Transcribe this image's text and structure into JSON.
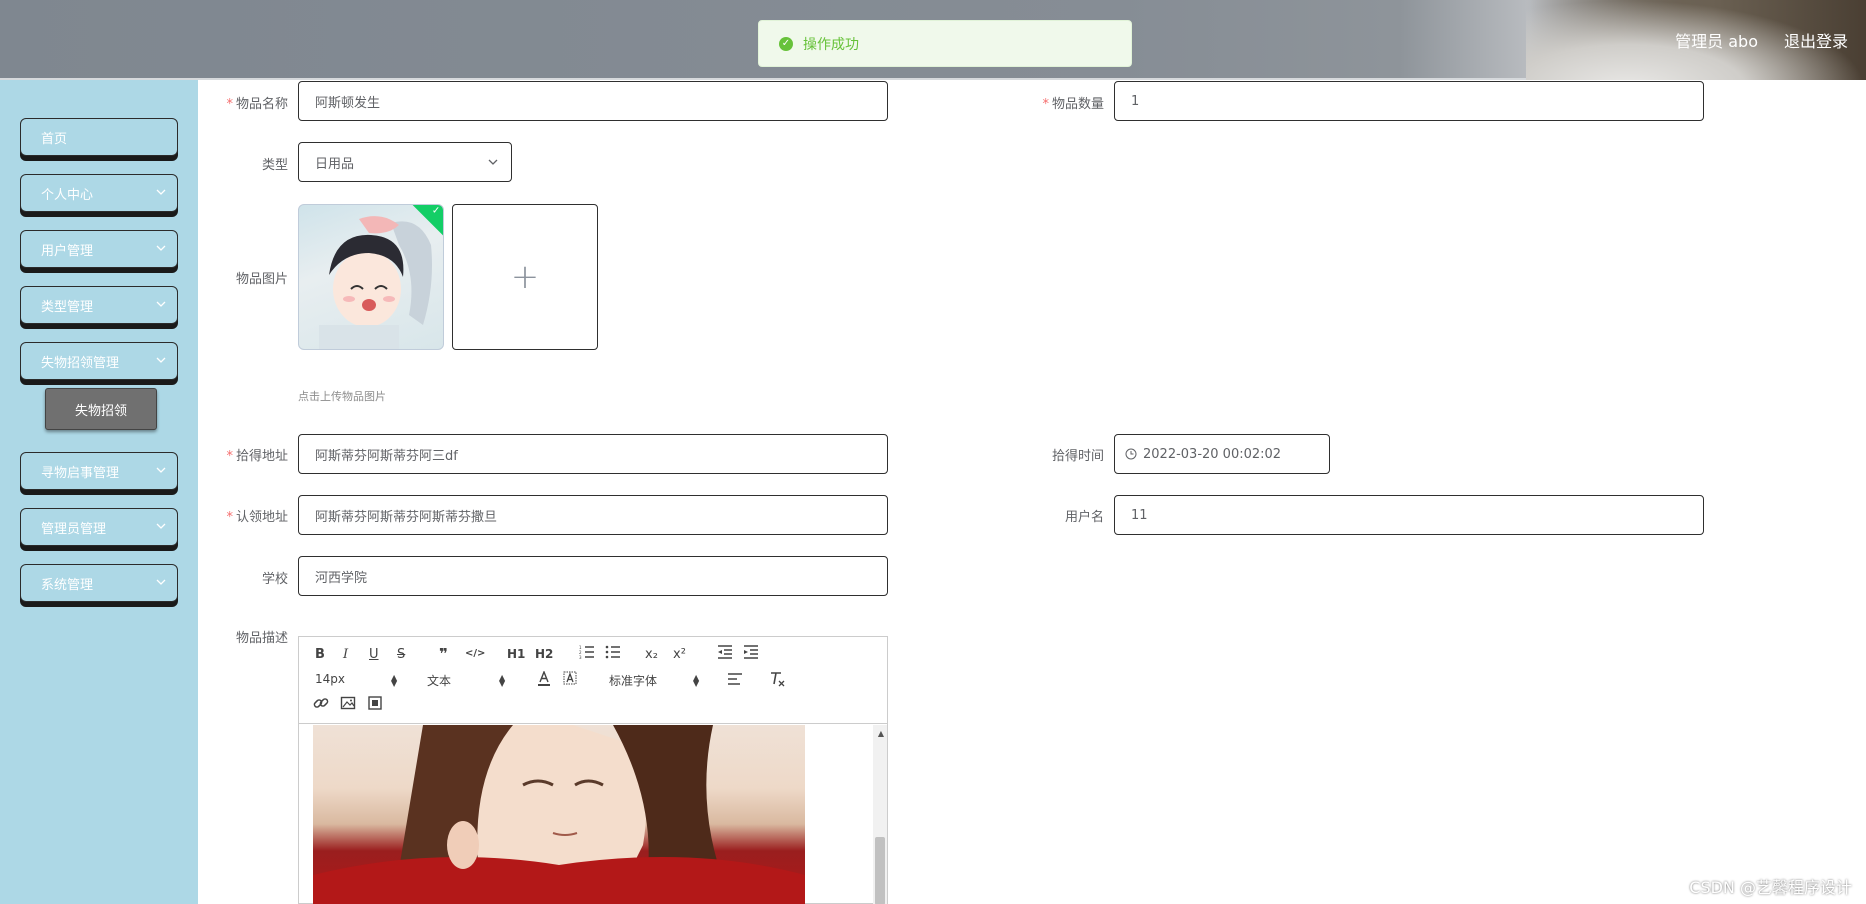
{
  "header": {
    "user_label": "管理员 abo",
    "logout_label": "退出登录"
  },
  "toast": {
    "message": "操作成功",
    "status_color": "#67c23a"
  },
  "sidebar": {
    "items": [
      {
        "label": "首页",
        "has_children": false
      },
      {
        "label": "个人中心",
        "has_children": true
      },
      {
        "label": "用户管理",
        "has_children": true
      },
      {
        "label": "类型管理",
        "has_children": true
      },
      {
        "label": "失物招领管理",
        "has_children": true
      },
      {
        "label": "寻物启事管理",
        "has_children": true
      },
      {
        "label": "管理员管理",
        "has_children": true
      },
      {
        "label": "系统管理",
        "has_children": true
      }
    ],
    "submenu_active": "失物招领"
  },
  "form": {
    "item_name": {
      "label": "物品名称",
      "value": "阿斯顿发生",
      "required": true
    },
    "item_quantity": {
      "label": "物品数量",
      "value": "1",
      "required": true
    },
    "item_type": {
      "label": "类型",
      "value": "日用品"
    },
    "item_image": {
      "label": "物品图片",
      "tip": "点击上传物品图片",
      "add_symbol": "+"
    },
    "found_address": {
      "label": "拾得地址",
      "value": "阿斯蒂芬阿斯蒂芬阿三df",
      "required": true
    },
    "found_time": {
      "label": "拾得时间",
      "value": "2022-03-20 00:02:02"
    },
    "claim_address": {
      "label": "认领地址",
      "value": "阿斯蒂芬阿斯蒂芬阿斯蒂芬撒旦",
      "required": true
    },
    "username": {
      "label": "用户名",
      "value": "11"
    },
    "school": {
      "label": "学校",
      "value": "河西学院"
    },
    "description": {
      "label": "物品描述"
    }
  },
  "editor": {
    "toolbar_row1": [
      "B",
      "I",
      "U",
      "S",
      "❞",
      "</>",
      "H1",
      "H2",
      "ol",
      "ul",
      "x₂",
      "x²",
      "outdent",
      "indent"
    ],
    "font_size": "14px",
    "block_format": "文本",
    "font_family": "标准字体"
  },
  "watermark": "CSDN @艺馨程序设计"
}
